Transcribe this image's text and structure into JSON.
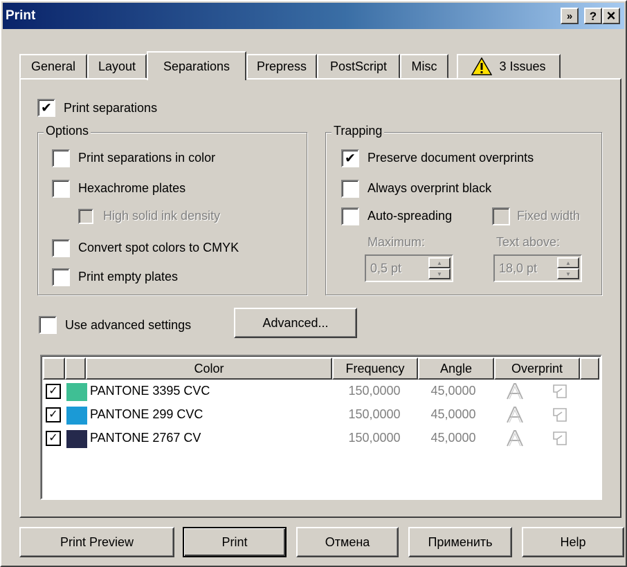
{
  "window": {
    "title": "Print",
    "buttons": {
      "screen": "»",
      "help": "?",
      "close": "×"
    }
  },
  "tabs": [
    {
      "label": "General"
    },
    {
      "label": "Layout"
    },
    {
      "label": "Separations",
      "active": true
    },
    {
      "label": "Prepress"
    },
    {
      "label": "PostScript"
    },
    {
      "label": "Misc"
    },
    {
      "label": "3 Issues",
      "icon": "warning-icon"
    }
  ],
  "print_separations": {
    "label": "Print separations",
    "checked": true
  },
  "options": {
    "title": "Options",
    "items": [
      {
        "label": "Print separations in color",
        "checked": false,
        "enabled": true
      },
      {
        "label": "Hexachrome plates",
        "checked": false,
        "enabled": true
      },
      {
        "label": "High solid ink density",
        "checked": false,
        "enabled": false
      },
      {
        "label": "Convert spot colors to CMYK",
        "checked": false,
        "enabled": true
      },
      {
        "label": "Print empty plates",
        "checked": false,
        "enabled": true
      }
    ]
  },
  "trapping": {
    "title": "Trapping",
    "preserve": {
      "label": "Preserve document overprints",
      "checked": true
    },
    "overprint_black": {
      "label": "Always overprint black",
      "checked": false
    },
    "auto_spreading": {
      "label": "Auto-spreading",
      "checked": false
    },
    "fixed_width": {
      "label": "Fixed width",
      "checked": false,
      "enabled": false
    },
    "maximum": {
      "label": "Maximum:",
      "value": "0,5 pt"
    },
    "text_above": {
      "label": "Text above:",
      "value": "18,0 pt"
    }
  },
  "advanced": {
    "use_label": "Use advanced settings",
    "use_checked": false,
    "button_label": "Advanced..."
  },
  "table": {
    "headers": {
      "color": "Color",
      "frequency": "Frequency",
      "angle": "Angle",
      "overprint": "Overprint"
    },
    "rows": [
      {
        "checked": true,
        "swatch": "#3fbf94",
        "name": "PANTONE 3395 CVC",
        "frequency": "150,0000",
        "angle": "45,0000"
      },
      {
        "checked": true,
        "swatch": "#1b9ad6",
        "name": "PANTONE 299 CVC",
        "frequency": "150,0000",
        "angle": "45,0000"
      },
      {
        "checked": true,
        "swatch": "#25294c",
        "name": "PANTONE 2767 CV",
        "frequency": "150,0000",
        "angle": "45,0000"
      }
    ]
  },
  "footer": {
    "print_preview": "Print Preview",
    "print": "Print",
    "cancel": "Отмена",
    "apply": "Применить",
    "help": "Help"
  },
  "colors": {
    "title_start": "#0a246a",
    "title_end": "#a6caf0",
    "face": "#d4d0c8",
    "warning": "#ffe000"
  }
}
